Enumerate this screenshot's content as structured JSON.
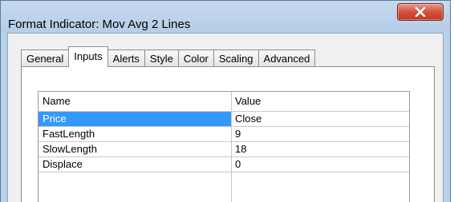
{
  "window": {
    "title": "Format Indicator: Mov Avg 2 Lines",
    "close_icon": "close-icon"
  },
  "tabs": [
    {
      "label": "General",
      "active": false
    },
    {
      "label": "Inputs",
      "active": true
    },
    {
      "label": "Alerts",
      "active": false
    },
    {
      "label": "Style",
      "active": false
    },
    {
      "label": "Color",
      "active": false
    },
    {
      "label": "Scaling",
      "active": false
    },
    {
      "label": "Advanced",
      "active": false
    }
  ],
  "inputs_table": {
    "headers": {
      "name": "Name",
      "value": "Value"
    },
    "rows": [
      {
        "name": "Price",
        "value": "Close",
        "selected": true
      },
      {
        "name": "FastLength",
        "value": "9",
        "selected": false
      },
      {
        "name": "SlowLength",
        "value": "18",
        "selected": false
      },
      {
        "name": "Displace",
        "value": "0",
        "selected": false
      }
    ]
  },
  "colors": {
    "selection": "#3399ff",
    "title_bar": "#b9d1ea",
    "close_button": "#c8442e"
  }
}
